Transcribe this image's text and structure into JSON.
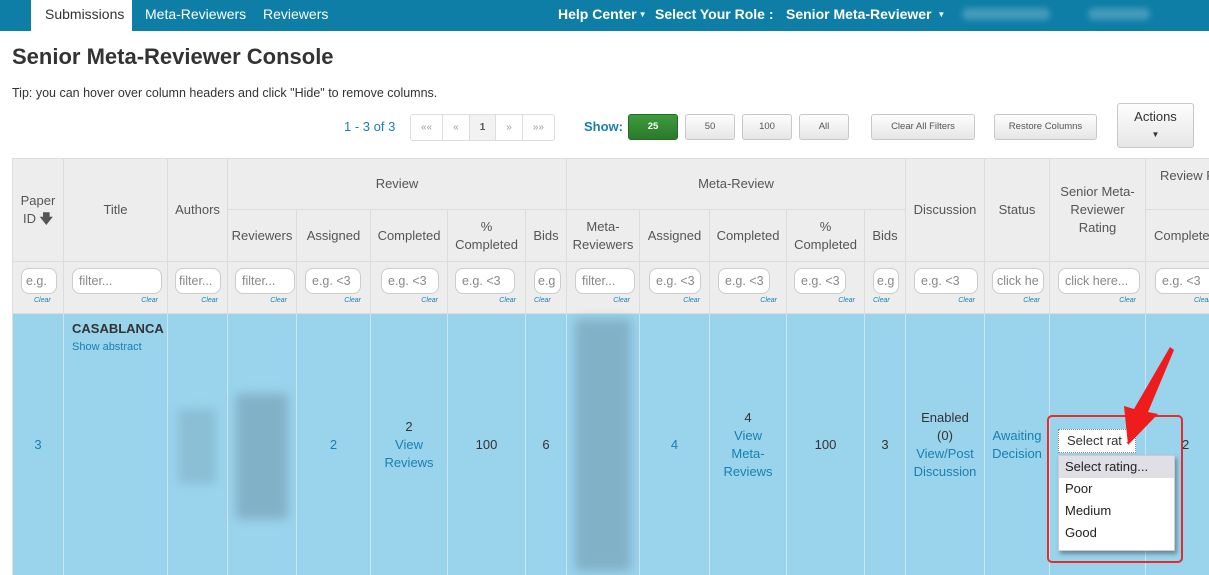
{
  "nav": {
    "tabs": [
      {
        "label": "Submissions",
        "active": true
      },
      {
        "label": "Meta-Reviewers",
        "active": false
      },
      {
        "label": "Reviewers",
        "active": false
      }
    ],
    "help_center": "Help Center",
    "select_role_label": "Select Your Role :",
    "role": "Senior Meta-Reviewer"
  },
  "page": {
    "title": "Senior Meta-Reviewer Console",
    "tip": "Tip: you can hover over column headers and click \"Hide\" to remove columns."
  },
  "pager": {
    "count": "1 - 3 of 3",
    "buttons": [
      "««",
      "«",
      "1",
      "»",
      "»»"
    ],
    "current": "1",
    "show_label": "Show:",
    "page_sizes": [
      "25",
      "50",
      "100",
      "All"
    ],
    "selected_size": "25",
    "clear_filters": "Clear All Filters",
    "restore_columns": "Restore Columns",
    "actions": "Actions"
  },
  "table": {
    "group_headers": {
      "review": "Review",
      "meta_review": "Meta-Review",
      "review_partial": "Review F",
      "review_partial2": "F"
    },
    "headers": {
      "paper_id": "Paper ID",
      "title": "Title",
      "authors": "Authors",
      "reviewers": "Reviewers",
      "assigned": "Assigned",
      "completed": "Completed",
      "pct_completed": "% Completed",
      "bids": "Bids",
      "meta_reviewers": "Meta-Reviewers",
      "discussion": "Discussion",
      "status": "Status",
      "smr_rating": "Senior Meta-Reviewer Rating",
      "completed_partial": "Complete"
    },
    "filters": {
      "eg": "e.g.",
      "filter": "filter...",
      "lt3": "e.g. <3",
      "eg_cut": "e.g",
      "click_cut": "click he",
      "click_here": "click here...",
      "clear": "Clear"
    },
    "row": {
      "paper_id": "3",
      "title": "CASABLANCA",
      "show_abstract": "Show abstract",
      "review_assigned": "2",
      "review_completed": "2",
      "view_reviews": "View Reviews",
      "review_pct": "100",
      "review_bids": "6",
      "meta_assigned": "4",
      "meta_completed": "4",
      "view_meta_reviews": "View Meta-Reviews",
      "meta_pct": "100",
      "meta_bids": "3",
      "discussion_status": "Enabled",
      "discussion_count": "(0)",
      "discussion_link": "View/Post Discussion",
      "status": "Awaiting Decision",
      "rating_select": "Select rat",
      "partial_value": "2"
    }
  },
  "rating_dropdown": {
    "options": [
      "Select rating...",
      "Poor",
      "Medium",
      "Good"
    ],
    "highlighted": "Select rating..."
  },
  "colors": {
    "navbar": "#0f7ea7",
    "row_highlight": "#9ad3ec",
    "link": "#1a7fb0",
    "primary_button": "#2f862f",
    "annotation": "#e52b2b"
  }
}
